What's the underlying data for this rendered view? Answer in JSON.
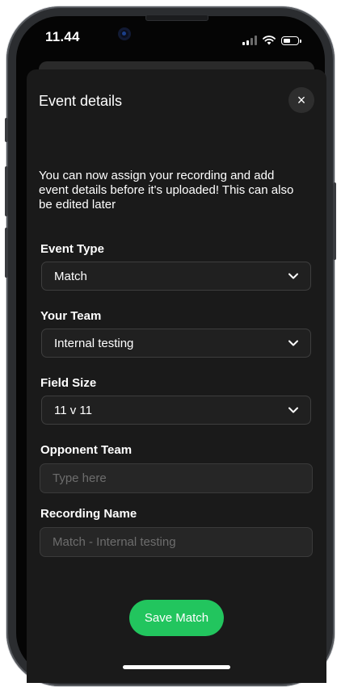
{
  "status_bar": {
    "time": "11.44"
  },
  "sheet": {
    "title": "Event details",
    "close_label": "×",
    "intro": "You can now assign your recording and add event details before it's uploaded! This can also be edited later"
  },
  "form": {
    "event_type": {
      "label": "Event Type",
      "value": "Match"
    },
    "your_team": {
      "label": "Your Team",
      "value": "Internal testing"
    },
    "field_size": {
      "label": "Field Size",
      "value": "11 v 11"
    },
    "opponent_team": {
      "label": "Opponent Team",
      "placeholder": "Type here"
    },
    "recording_name": {
      "label": "Recording Name",
      "placeholder": "Match - Internal testing"
    }
  },
  "actions": {
    "save_label": "Save Match"
  },
  "colors": {
    "accent": "#22c55e",
    "sheet_bg": "#1a1a1a",
    "field_bg": "#202020"
  }
}
